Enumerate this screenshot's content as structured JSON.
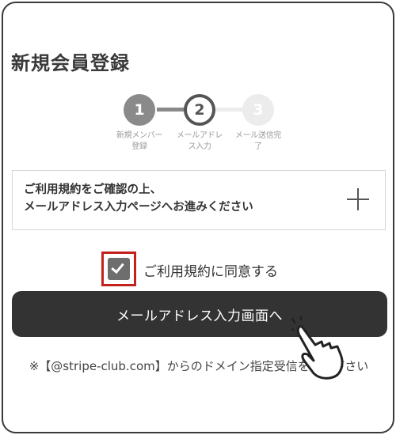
{
  "page": {
    "title": "新規会員登録"
  },
  "stepper": {
    "steps": [
      {
        "number": "1",
        "label_line1": "新規メンバー",
        "label_line2": "登録"
      },
      {
        "number": "2",
        "label_line1": "メールアドレ",
        "label_line2": "ス入力"
      },
      {
        "number": "3",
        "label_line1": "メール送信完",
        "label_line2": "了"
      }
    ],
    "current": 2
  },
  "terms": {
    "line1": "ご利用規約をご確認の上、",
    "line2": "メールアドレス入力ページへお進みください",
    "expand_icon": "plus-icon"
  },
  "agree": {
    "label": "ご利用規約に同意する",
    "checked": true
  },
  "primary_button": {
    "label": "メールアドレス入力画面へ"
  },
  "note": {
    "text": "※【@stripe-club.com】からのドメイン指定受信をして下さい"
  },
  "colors": {
    "button_bg": "#333333",
    "highlight": "#c4211d",
    "step_done": "#8a8a8a",
    "step_pending": "#ececec"
  }
}
